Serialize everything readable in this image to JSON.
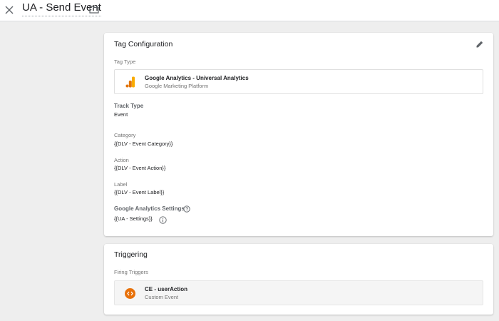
{
  "header": {
    "close_icon": "close-icon",
    "title": "UA - Send Event",
    "folder_icon": "folder-icon"
  },
  "tag_configuration": {
    "title": "Tag Configuration",
    "edit_icon": "pencil-icon",
    "tag_type_label": "Tag Type",
    "tag_type": {
      "name": "Google Analytics - Universal Analytics",
      "subtitle": "Google Marketing Platform",
      "icon": "google-analytics-icon"
    },
    "track_type_label": "Track Type",
    "track_type_value": "Event",
    "category_label": "Category",
    "category_value": "{{DLV - Event Category}}",
    "action_label": "Action",
    "action_value": "{{DLV - Event Action}}",
    "label_label": "Label",
    "label_value": "{{DLV - Event Label}}",
    "ga_settings_label": "Google Analytics Settings",
    "ga_settings_value": "{{UA - Settings}}"
  },
  "triggering": {
    "title": "Triggering",
    "firing_triggers_label": "Firing Triggers",
    "trigger": {
      "name": "CE - userAction",
      "subtitle": "Custom Event",
      "icon": "custom-event-icon"
    }
  },
  "colors": {
    "ga_orange": "#f9ab00",
    "ga_dark_orange": "#e37400",
    "custom_event_orange": "#e8710a",
    "background": "#eeeeee"
  }
}
